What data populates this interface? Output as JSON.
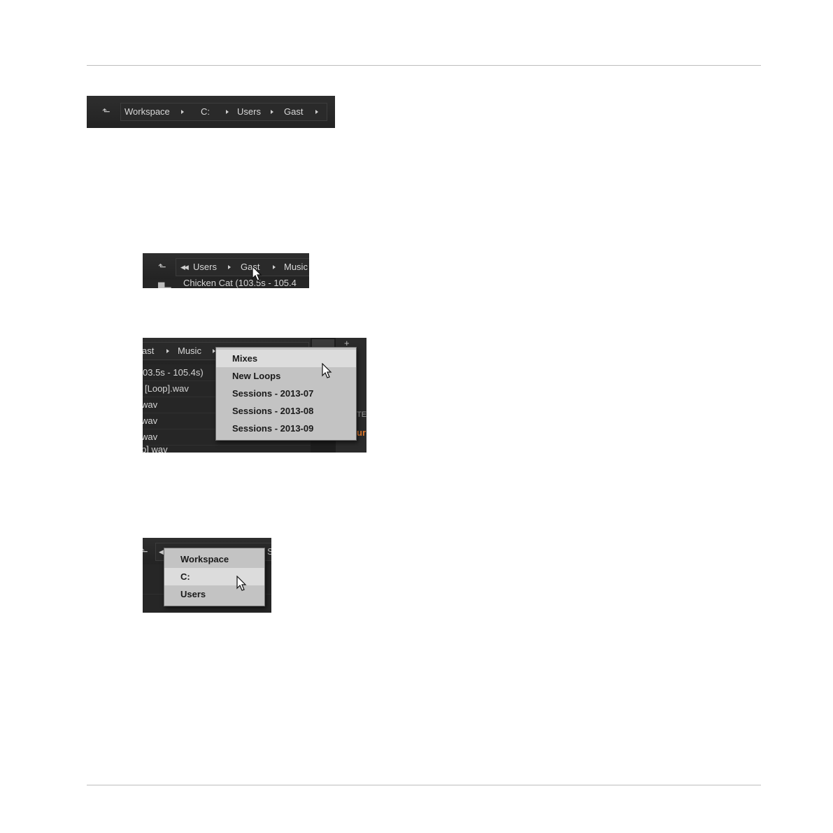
{
  "fig1": {
    "crumbs": [
      "Workspace",
      "C:",
      "Users",
      "Gast"
    ]
  },
  "fig2": {
    "crumbs": [
      "Users",
      "Gast",
      "Music"
    ],
    "row_text": "Chicken Cat (103.5s - 105.4"
  },
  "fig3": {
    "crumbs": [
      "ast",
      "Music"
    ],
    "rows": [
      "03.5s - 105.4s)",
      "[Loop].wav",
      "wav",
      "wav",
      "wav",
      "p] wav"
    ],
    "side_text": [
      "TE",
      "ur"
    ],
    "menu": [
      "Mixes",
      "New Loops",
      "Sessions - 2013-07",
      "Sessions - 2013-08",
      "Sessions - 2013-09"
    ]
  },
  "fig4": {
    "menu": [
      "Workspace",
      "C:",
      "Users"
    ],
    "edge_letter": "S"
  },
  "colors": {
    "accent_orange": "#e07a2e"
  }
}
